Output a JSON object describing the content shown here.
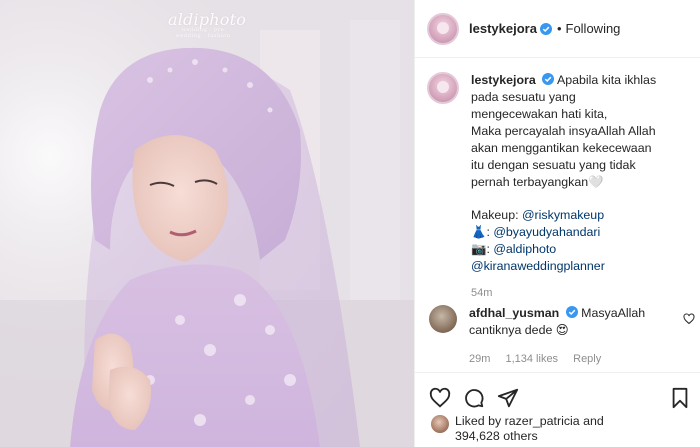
{
  "photo": {
    "watermark": "aldiphoto",
    "watermark_sub": "wedding · pre wedding · fashion"
  },
  "header": {
    "username": "lestykejora",
    "separator": "•",
    "follow_status": "Following"
  },
  "caption": {
    "username": "lestykejora",
    "lines": [
      "Apabila kita ikhlas",
      "pada sesuatu yang",
      "mengecewakan hati kita,",
      "Maka percayalah insyaAllah Allah",
      "akan menggantikan kekecewaan",
      "itu dengan sesuatu yang tidak",
      "pernah terbayangkan🤍"
    ],
    "makeup_label": "Makeup: ",
    "makeup_mention": "@riskymakeup",
    "dress_emoji": "👗",
    "dress_mention": "@byayudyahandari",
    "camera_emoji": "📷",
    "camera_mention": "@aldiphoto",
    "planner_mention": "@kiranaweddingplanner",
    "time": "54m"
  },
  "comment": {
    "username": "afdhal_yusman",
    "text_line1": "MasyaAllah",
    "text_line2": "cantiknya dede 😍",
    "time": "29m",
    "likes": "1,134 likes",
    "reply": "Reply"
  },
  "likes": {
    "line1": "Liked by razer_patricia and",
    "line2": "394,628 others"
  },
  "icons": [
    "verified-badge-icon",
    "heart-icon",
    "comment-icon",
    "share-icon",
    "bookmark-icon"
  ],
  "colors": {
    "verified": "#3897f0",
    "mention": "#00376b",
    "meta": "#8e8e8e"
  }
}
